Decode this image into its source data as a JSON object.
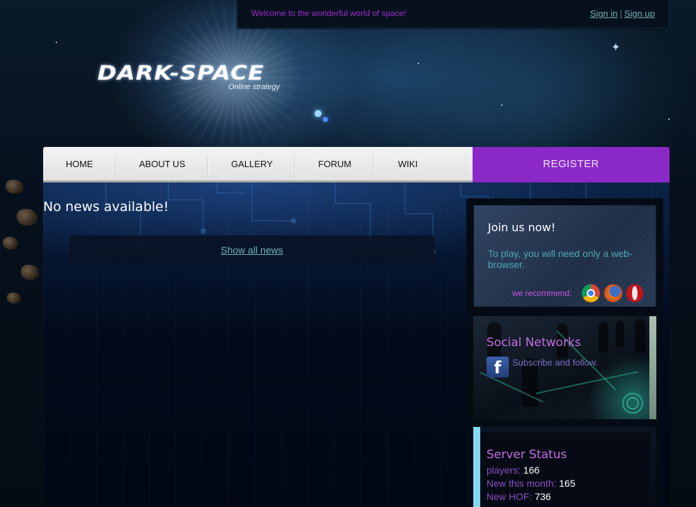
{
  "topbar": {
    "welcome": "Welcome to the wonderful world of space!",
    "sign_in": "Sign in",
    "separator": "|",
    "sign_up": "Sign up"
  },
  "logo": {
    "name": "DARK-SPACE",
    "tagline": "Online strategy"
  },
  "nav": {
    "items": [
      {
        "label": "HOME"
      },
      {
        "label": "ABOUT US"
      },
      {
        "label": "GALLERY"
      },
      {
        "label": "FORUM"
      },
      {
        "label": "WIKI"
      }
    ],
    "register": "REGISTER"
  },
  "news": {
    "empty_message": "No news available!",
    "show_all": "Show all news"
  },
  "sidebar": {
    "join": {
      "title": "Join us now!",
      "text": "To play, you will need only a web-browser.",
      "recommend": "we recommend:",
      "browsers": [
        "chrome-icon",
        "firefox-icon",
        "opera-icon"
      ]
    },
    "social": {
      "title": "Social Networks",
      "subscribe": "Subscribe and follow.",
      "icon": "facebook-icon"
    },
    "server": {
      "title": "Server Status",
      "stats": [
        {
          "label": "players:",
          "value": "166"
        },
        {
          "label": "New this month:",
          "value": "165"
        },
        {
          "label": "New HOF:",
          "value": "736"
        }
      ]
    }
  },
  "colors": {
    "accent_purple": "#8a28c8",
    "link_teal": "#6fb3b9",
    "heading_purple": "#c46ee0"
  }
}
